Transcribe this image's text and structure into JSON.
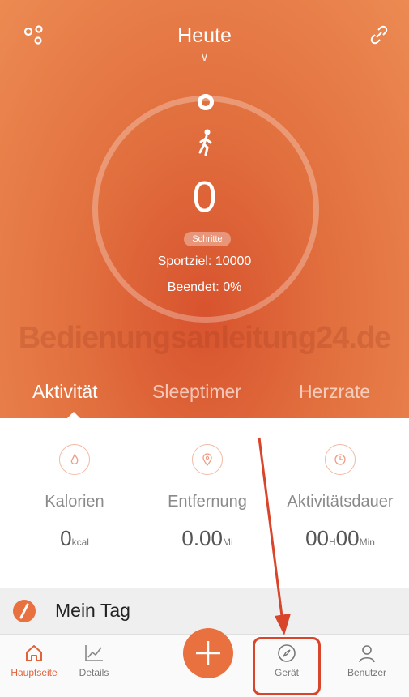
{
  "header": {
    "title": "Heute"
  },
  "summary": {
    "steps_value": "0",
    "steps_label": "Schritte",
    "goal": "Sportziel: 10000",
    "completed": "Beendet: 0%"
  },
  "watermark": "Bedienungsanleitung24.de",
  "tabs": [
    {
      "label": "Aktivität",
      "active": true
    },
    {
      "label": "Sleeptimer",
      "active": false
    },
    {
      "label": "Herzrate",
      "active": false
    }
  ],
  "metrics": [
    {
      "label": "Kalorien",
      "value": "0",
      "unit": "kcal",
      "icon": "flame-icon"
    },
    {
      "label": "Entfernung",
      "value": "0.00",
      "unit": "Mi",
      "icon": "location-pin-icon"
    },
    {
      "label": "Aktivitätsdauer",
      "value_h": "00",
      "unit_h": "H",
      "value_m": "00",
      "unit_m": "Min",
      "icon": "clock-icon"
    }
  ],
  "my_day": {
    "label": "Mein Tag"
  },
  "nav": [
    {
      "label": "Hauptseite",
      "icon": "home-icon",
      "active": true
    },
    {
      "label": "Details",
      "icon": "chart-icon",
      "active": false
    },
    {
      "label": "",
      "icon": "plus-icon",
      "active": false
    },
    {
      "label": "Gerät",
      "icon": "compass-icon",
      "active": false
    },
    {
      "label": "Benutzer",
      "icon": "user-icon",
      "active": false
    }
  ],
  "colors": {
    "accent": "#e9703f",
    "annotation": "#d9452b"
  }
}
